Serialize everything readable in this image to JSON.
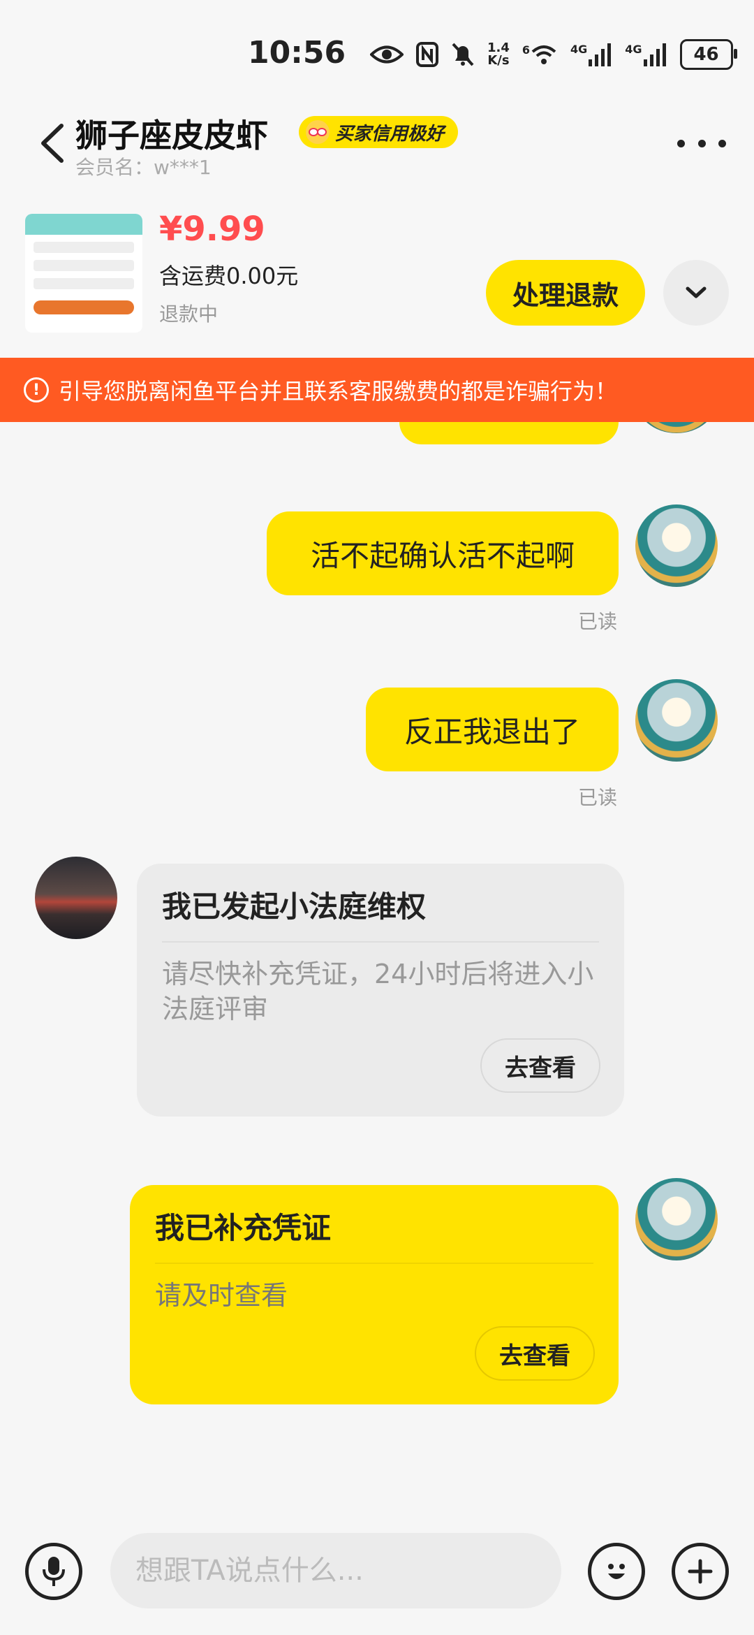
{
  "status_bar": {
    "time": "10:56",
    "net_speed_value": "1.4",
    "net_speed_unit": "K/s",
    "wifi_label": "6",
    "signal1_label": "4G",
    "signal2_label": "4G",
    "battery": "46"
  },
  "header": {
    "title": "狮子座皮皮虾",
    "badge": "买家信用极好",
    "member": "会员名：w***1"
  },
  "product": {
    "price": "¥9.99",
    "shipping": "含运费0.00元",
    "status": "退款中",
    "refund_button": "处理退款"
  },
  "warning": {
    "text": "引导您脱离闲鱼平台并且联系客服缴费的都是诈骗行为！"
  },
  "messages": [
    {
      "text": "活不起确认活不起啊",
      "read": "已读"
    },
    {
      "text": "反正我退出了",
      "read": "已读"
    }
  ],
  "card_other": {
    "title": "我已发起小法庭维权",
    "desc": "请尽快补充凭证，24小时后将进入小法庭评审",
    "button": "去查看"
  },
  "card_me": {
    "title": "我已补充凭证",
    "desc": "请及时查看",
    "button": "去查看"
  },
  "input": {
    "placeholder": "想跟TA说点什么..."
  },
  "colors": {
    "accent_yellow": "#ffe300",
    "warning_orange": "#ff5a22",
    "price_red": "#ff4d4f"
  }
}
